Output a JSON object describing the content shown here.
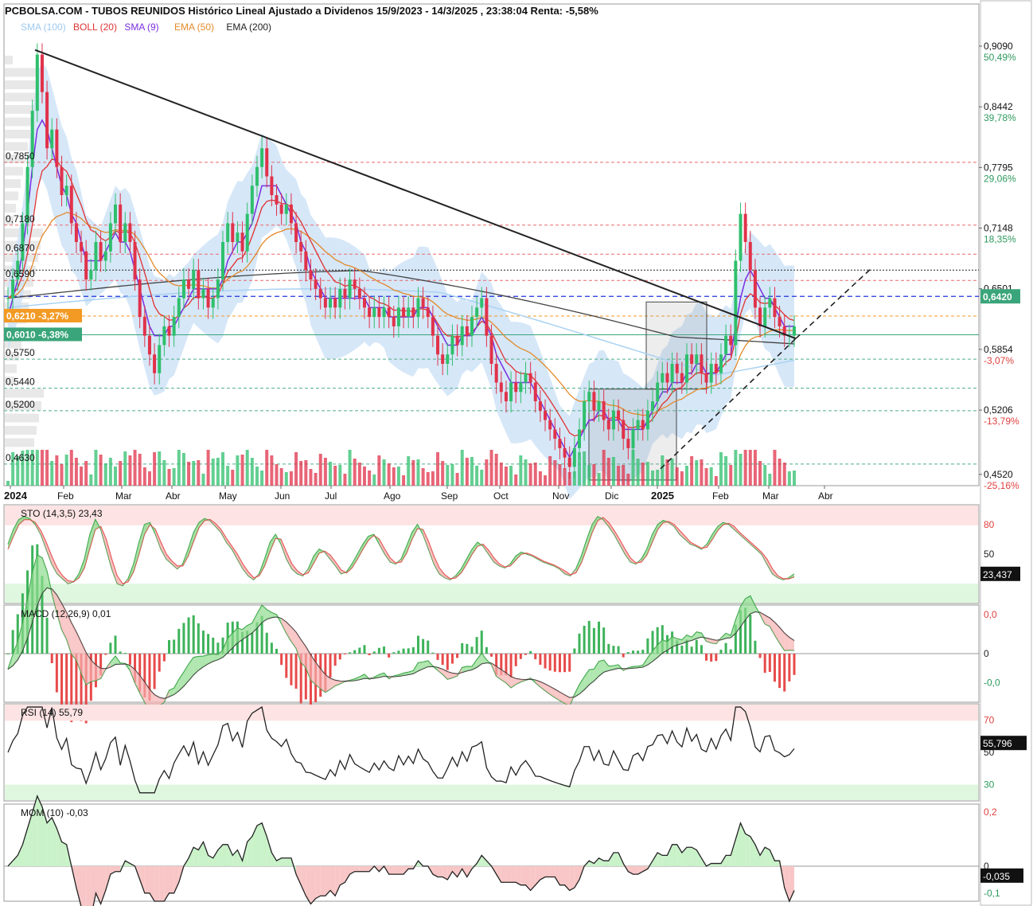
{
  "header": {
    "title": "PCBOLSA.COM - TUBOS REUNIDOS Histórico Lineal Ajustado a Dividenos 15/9/2023 - 14/3/2025 , 23:38:04 Renta: -5,58%"
  },
  "legend": [
    {
      "label": "SMA (100)",
      "color": "#9cc9ef"
    },
    {
      "label": "BOLL (20)",
      "color": "#e03232"
    },
    {
      "label": "SMA (9)",
      "color": "#7a2ee0"
    },
    {
      "label": "EMA (50)",
      "color": "#e3892a"
    },
    {
      "label": "EMA (200)",
      "color": "#333333"
    }
  ],
  "colors": {
    "up": "#2fbf6d",
    "down": "#e0324a",
    "band": "#cfe3f7",
    "sma100": "#a9d2f2",
    "boll": "#e03232",
    "sma9": "#7a2ee0",
    "ema50": "#e3892a",
    "ema200": "#444444",
    "badge_orange": "#f39a24",
    "badge_green": "#3aa57a",
    "badge_black": "#111111"
  },
  "chart_data": [
    {
      "type": "line",
      "name_id": "price",
      "x_labels": [
        "2024",
        "Feb",
        "Mar",
        "Abr",
        "May",
        "Jun",
        "Jul",
        "Ago",
        "Sep",
        "Oct",
        "Nov",
        "Dic",
        "2025",
        "Feb",
        "Mar",
        "Abr"
      ],
      "ylim": [
        0.44,
        0.92
      ],
      "right_ticks": [
        {
          "value": 0.909,
          "label": "0,9090",
          "pct": "50,49%",
          "pct_color": "#2e9a5e"
        },
        {
          "value": 0.8442,
          "label": "0,8442",
          "pct": "39,78%",
          "pct_color": "#2e9a5e"
        },
        {
          "value": 0.7795,
          "label": "0,7795",
          "pct": "29,06%",
          "pct_color": "#2e9a5e"
        },
        {
          "value": 0.7148,
          "label": "0,7148",
          "pct": "18,35%",
          "pct_color": "#2e9a5e"
        },
        {
          "value": 0.6501,
          "label": "0,6501",
          "pct": "",
          "pct_color": "#2e9a5e"
        },
        {
          "value": 0.5854,
          "label": "0,5854",
          "pct": "-3,07%",
          "pct_color": "#e04040"
        },
        {
          "value": 0.5206,
          "label": "0,5206",
          "pct": "-13,79%",
          "pct_color": "#e04040"
        },
        {
          "value": 0.452,
          "label": "0,4520",
          "pct": "-25,16%",
          "pct_color": "#e04040"
        }
      ],
      "left_levels": [
        {
          "value": 0.785,
          "label": "0,7850",
          "line": "#e86a6a"
        },
        {
          "value": 0.718,
          "label": "0,7180",
          "line": "#e86a6a"
        },
        {
          "value": 0.687,
          "label": "0,6870",
          "line": "#e86a6a"
        },
        {
          "value": 0.659,
          "label": "0,6590",
          "line": "#e86a6a"
        },
        {
          "value": 0.575,
          "label": "0,5750",
          "line": "#4fae86"
        },
        {
          "value": 0.544,
          "label": "0,5440",
          "line": "#4fae86"
        },
        {
          "value": 0.52,
          "label": "0,5200",
          "line": "#4fae86"
        },
        {
          "value": 0.463,
          "label": "0,4630",
          "line": "#4fae86"
        }
      ],
      "badges": [
        {
          "value": 0.621,
          "label": "0,6210",
          "pct": "-3,27%",
          "color": "#f39a24"
        },
        {
          "value": 0.601,
          "label": "0,6010",
          "pct": "-6,38%",
          "color": "#3aa57a"
        },
        {
          "value": 0.642,
          "label": "0,6420",
          "color": "#3aa57a"
        }
      ],
      "close": [
        0.64,
        0.66,
        0.68,
        0.72,
        0.78,
        0.84,
        0.9,
        0.86,
        0.8,
        0.82,
        0.78,
        0.75,
        0.76,
        0.72,
        0.7,
        0.69,
        0.66,
        0.67,
        0.7,
        0.68,
        0.69,
        0.72,
        0.74,
        0.7,
        0.72,
        0.7,
        0.66,
        0.62,
        0.6,
        0.58,
        0.56,
        0.59,
        0.61,
        0.6,
        0.62,
        0.64,
        0.66,
        0.65,
        0.67,
        0.64,
        0.65,
        0.63,
        0.64,
        0.66,
        0.7,
        0.72,
        0.7,
        0.71,
        0.69,
        0.73,
        0.76,
        0.78,
        0.8,
        0.77,
        0.75,
        0.74,
        0.73,
        0.74,
        0.72,
        0.7,
        0.69,
        0.67,
        0.66,
        0.65,
        0.64,
        0.63,
        0.64,
        0.63,
        0.65,
        0.64,
        0.66,
        0.65,
        0.64,
        0.63,
        0.62,
        0.63,
        0.62,
        0.63,
        0.62,
        0.61,
        0.63,
        0.62,
        0.63,
        0.62,
        0.64,
        0.63,
        0.62,
        0.6,
        0.58,
        0.57,
        0.58,
        0.6,
        0.59,
        0.61,
        0.6,
        0.62,
        0.63,
        0.64,
        0.6,
        0.57,
        0.55,
        0.54,
        0.53,
        0.55,
        0.54,
        0.55,
        0.56,
        0.55,
        0.53,
        0.52,
        0.51,
        0.5,
        0.49,
        0.48,
        0.47,
        0.46,
        0.48,
        0.5,
        0.53,
        0.54,
        0.52,
        0.53,
        0.51,
        0.5,
        0.52,
        0.51,
        0.49,
        0.48,
        0.5,
        0.51,
        0.5,
        0.52,
        0.53,
        0.55,
        0.56,
        0.55,
        0.57,
        0.56,
        0.55,
        0.58,
        0.57,
        0.58,
        0.56,
        0.55,
        0.57,
        0.56,
        0.58,
        0.6,
        0.59,
        0.68,
        0.73,
        0.7,
        0.67,
        0.63,
        0.61,
        0.63,
        0.64,
        0.62,
        0.61,
        0.6,
        0.6,
        0.61
      ],
      "sma9": [
        0.62,
        0.64,
        0.66,
        0.69,
        0.73,
        0.78,
        0.82,
        0.83,
        0.82,
        0.8,
        0.78,
        0.76,
        0.75,
        0.73,
        0.72,
        0.7,
        0.68,
        0.68,
        0.68,
        0.68,
        0.69,
        0.7,
        0.71,
        0.7,
        0.7,
        0.69,
        0.67,
        0.65,
        0.63,
        0.61,
        0.6,
        0.6,
        0.6,
        0.61,
        0.61,
        0.62,
        0.63,
        0.64,
        0.65,
        0.65,
        0.65,
        0.65,
        0.65,
        0.65,
        0.66,
        0.68,
        0.69,
        0.7,
        0.7,
        0.71,
        0.72,
        0.74,
        0.76,
        0.76,
        0.76,
        0.76,
        0.75,
        0.74,
        0.73,
        0.72,
        0.7,
        0.69,
        0.67,
        0.66,
        0.65,
        0.64,
        0.64,
        0.64,
        0.64,
        0.64,
        0.64,
        0.64,
        0.64,
        0.64,
        0.63,
        0.63,
        0.63,
        0.63,
        0.62,
        0.62,
        0.62,
        0.62,
        0.62,
        0.62,
        0.63,
        0.63,
        0.63,
        0.62,
        0.61,
        0.6,
        0.59,
        0.59,
        0.59,
        0.6,
        0.6,
        0.6,
        0.61,
        0.62,
        0.61,
        0.6,
        0.58,
        0.57,
        0.56,
        0.55,
        0.55,
        0.55,
        0.55,
        0.55,
        0.54,
        0.53,
        0.52,
        0.51,
        0.5,
        0.49,
        0.48,
        0.47,
        0.48,
        0.49,
        0.5,
        0.51,
        0.51,
        0.52,
        0.52,
        0.51,
        0.51,
        0.51,
        0.5,
        0.5,
        0.5,
        0.5,
        0.5,
        0.51,
        0.52,
        0.53,
        0.54,
        0.54,
        0.55,
        0.55,
        0.55,
        0.56,
        0.56,
        0.57,
        0.57,
        0.56,
        0.56,
        0.56,
        0.57,
        0.58,
        0.58,
        0.61,
        0.64,
        0.66,
        0.67,
        0.66,
        0.65,
        0.64,
        0.64,
        0.63,
        0.62,
        0.61,
        0.61,
        0.61
      ]
    },
    {
      "type": "line",
      "name_id": "sto",
      "title": "STO (14,3,5)",
      "value_label": "23,43",
      "last_badge": "23,437",
      "ylim": [
        0,
        100
      ],
      "ticks": [
        {
          "value": 80,
          "label": "80",
          "color": "#e04040"
        },
        {
          "value": 50,
          "label": "50",
          "color": "#222222"
        }
      ],
      "k": [
        60,
        75,
        85,
        88,
        86,
        80,
        70,
        55,
        40,
        30,
        25,
        20,
        22,
        30,
        45,
        70,
        85,
        75,
        55,
        35,
        20,
        18,
        25,
        40,
        62,
        80,
        82,
        70,
        55,
        45,
        40,
        35,
        40,
        55,
        72,
        82,
        86,
        84,
        78,
        72,
        62,
        55,
        45,
        35,
        28,
        24,
        30,
        45,
        62,
        70,
        60,
        45,
        35,
        30,
        28,
        35,
        48,
        55,
        52,
        45,
        38,
        30,
        32,
        40,
        50,
        60,
        68,
        70,
        60,
        50,
        42,
        40,
        45,
        58,
        72,
        80,
        70,
        55,
        40,
        30,
        26,
        24,
        28,
        35,
        45,
        55,
        62,
        58,
        50,
        42,
        38,
        36,
        40,
        48,
        52,
        50,
        48,
        45,
        42,
        40,
        38,
        35,
        30,
        28,
        35,
        48,
        65,
        80,
        88,
        85,
        78,
        70,
        60,
        50,
        42,
        40,
        45,
        55,
        70,
        80,
        84,
        82,
        78,
        70,
        65,
        60,
        58,
        55,
        60,
        70,
        78,
        82,
        80,
        75,
        70,
        65,
        60,
        55,
        50,
        40,
        30,
        26,
        24,
        26,
        30
      ],
      "d": [
        55,
        68,
        80,
        85,
        85,
        82,
        74,
        62,
        48,
        36,
        28,
        23,
        22,
        26,
        36,
        56,
        75,
        78,
        65,
        45,
        28,
        20,
        22,
        32,
        50,
        70,
        80,
        75,
        62,
        50,
        43,
        38,
        38,
        48,
        63,
        77,
        84,
        85,
        81,
        75,
        66,
        58,
        50,
        40,
        32,
        26,
        28,
        38,
        53,
        66,
        65,
        52,
        40,
        33,
        29,
        31,
        41,
        51,
        53,
        49,
        42,
        34,
        31,
        36,
        45,
        55,
        64,
        69,
        65,
        55,
        46,
        41,
        42,
        51,
        65,
        76,
        75,
        63,
        48,
        36,
        29,
        25,
        26,
        31,
        40,
        50,
        58,
        60,
        54,
        46,
        40,
        37,
        38,
        44,
        50,
        51,
        49,
        46,
        43,
        41,
        39,
        36,
        33,
        29,
        31,
        41,
        56,
        72,
        84,
        87,
        82,
        74,
        65,
        55,
        46,
        41,
        42,
        49,
        62,
        75,
        82,
        83,
        80,
        74,
        68,
        62,
        59,
        56,
        57,
        65,
        74,
        80,
        81,
        78,
        72,
        67,
        62,
        57,
        52,
        45,
        35,
        28,
        25,
        25,
        27
      ]
    },
    {
      "type": "line",
      "name_id": "macd",
      "title": "MACD (12,26,9)",
      "value_label": "0,01",
      "ylim": [
        -0.05,
        0.05
      ],
      "ticks": [
        {
          "value": 0.04,
          "label": "0,0",
          "color": "#e04040"
        },
        {
          "value": 0,
          "label": "0",
          "color": "#222222"
        },
        {
          "value": -0.03,
          "label": "-0,0",
          "color": "#2e9a5e"
        }
      ]
    },
    {
      "type": "line",
      "name_id": "rsi",
      "title": "RSI (14)",
      "value_label": "55,79",
      "last_badge": "55,796",
      "ylim": [
        20,
        80
      ],
      "ticks": [
        {
          "value": 70,
          "label": "70",
          "color": "#e04040"
        },
        {
          "value": 50,
          "label": "50",
          "color": "#222222"
        },
        {
          "value": 30,
          "label": "30",
          "color": "#2e9a5e"
        }
      ]
    },
    {
      "type": "area",
      "name_id": "mom",
      "title": "MOM (10)",
      "value_label": "-0,03",
      "last_badge": "-0,035",
      "ylim": [
        -0.13,
        0.23
      ],
      "ticks": [
        {
          "value": 0.2,
          "label": "0,2",
          "color": "#e04040"
        },
        {
          "value": 0,
          "label": "0",
          "color": "#222222"
        },
        {
          "value": -0.1,
          "label": "-0,1",
          "color": "#2e9a5e"
        }
      ]
    }
  ]
}
